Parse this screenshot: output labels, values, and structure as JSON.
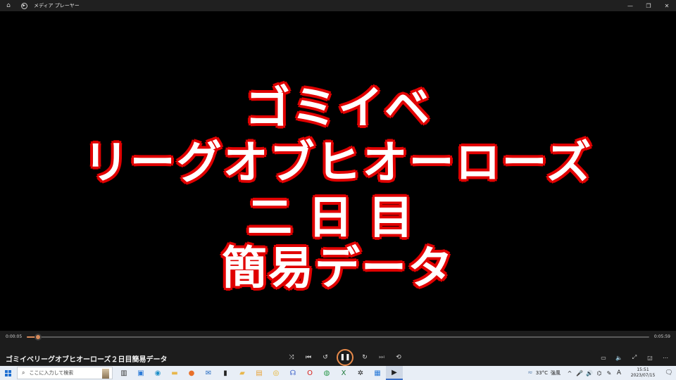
{
  "window": {
    "app_title": "メディア プレーヤー",
    "icons": {
      "home": "home-icon",
      "app": "media-player-icon",
      "minimize": "minimize-icon",
      "maximize": "restore-icon",
      "close": "close-icon"
    }
  },
  "video": {
    "caption_lines": [
      "ゴミイベ",
      "リーグオブヒオーローズ",
      "二日目",
      "簡易データ"
    ],
    "caption_fill": "#ffffff",
    "caption_outline": "#ff1a1a"
  },
  "player": {
    "current_time": "0:00:05",
    "duration": "0:05:59",
    "progress_fraction": 0.018,
    "media_title": "ゴミイベリーグオブヒオーローズ２日目簡易データ",
    "accent_color": "#e88a4a",
    "transport_icons": [
      "shuffle-icon",
      "previous-icon",
      "rewind-10-icon",
      "pause-icon",
      "forward-30-icon",
      "next-icon",
      "repeat-icon"
    ],
    "right_icons": [
      "captions-icon",
      "volume-icon",
      "fullscreen-icon",
      "mini-player-icon",
      "more-icon"
    ]
  },
  "taskbar": {
    "search_placeholder": "ここに入力して検索",
    "pinned_apps": [
      "task-view-icon",
      "store-icon",
      "edge-icon",
      "explorer-icon",
      "firefox-icon",
      "mail-icon",
      "tablet-icon",
      "folder-icon",
      "app-icon",
      "chrome-canary-icon",
      "headphones-icon",
      "opera-icon",
      "chrome-icon",
      "excel-icon",
      "settings-icon",
      "photos-icon",
      "media-player-icon"
    ],
    "weather_temp": "33°C",
    "weather_desc": "強風",
    "ime": "A",
    "time": "15:51",
    "date": "2023/07/15"
  }
}
